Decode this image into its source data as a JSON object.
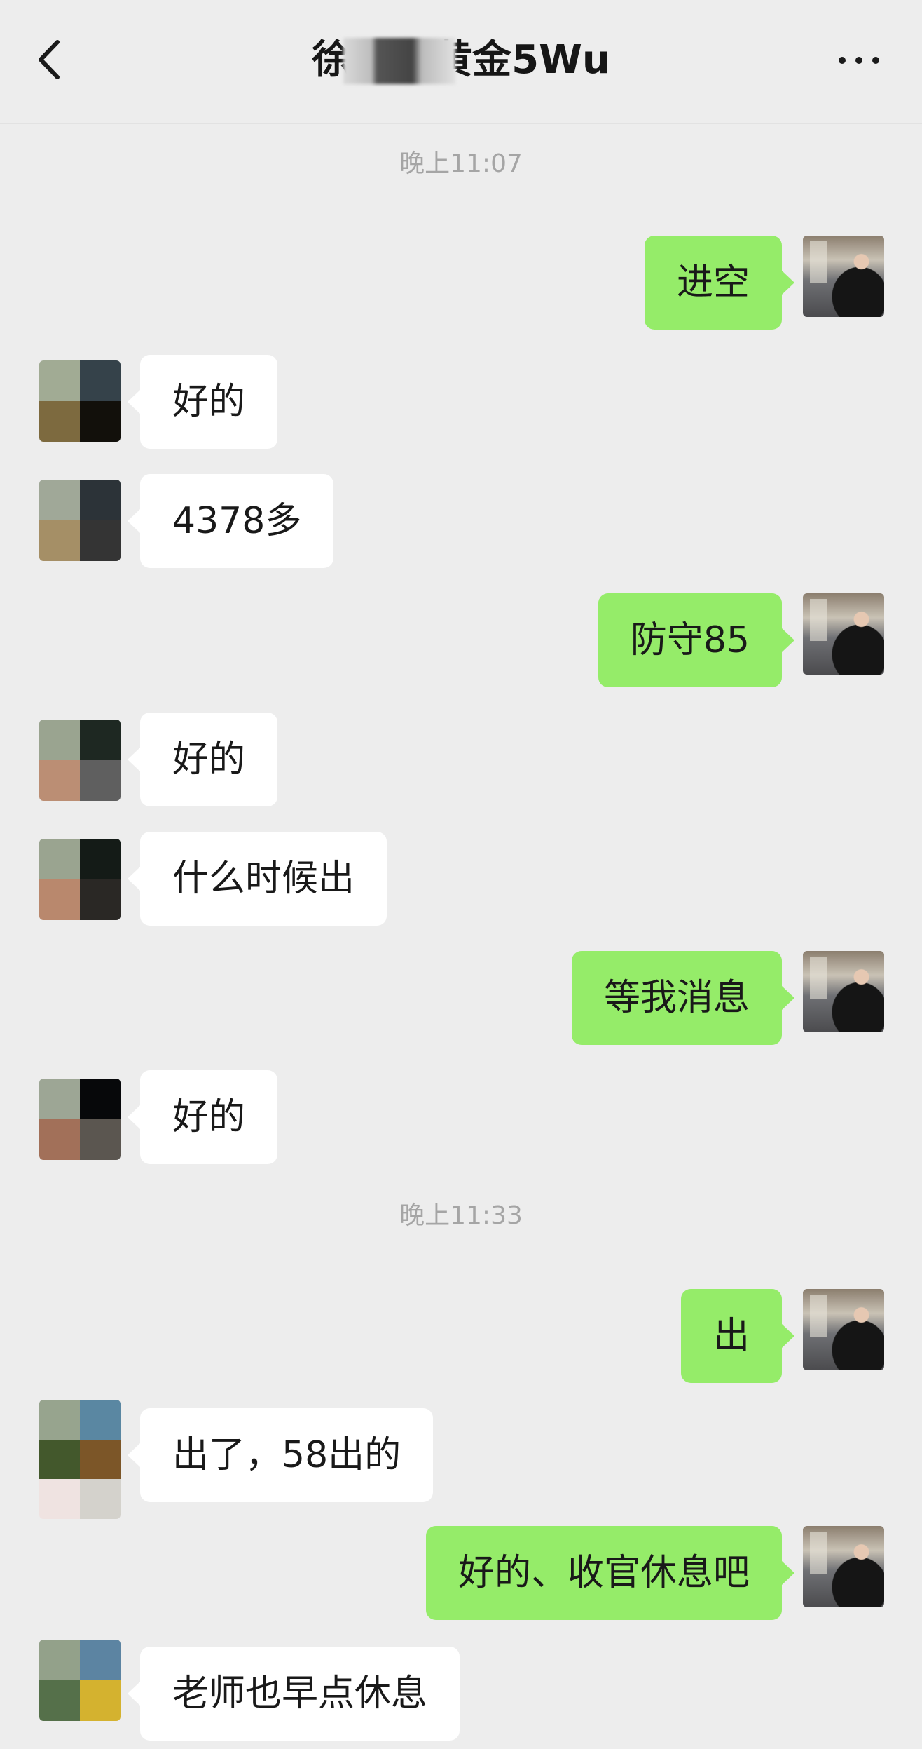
{
  "header": {
    "title": "徐      黄金5Wu",
    "back_icon": "chevron-left-icon",
    "more_icon": "more-dots-icon"
  },
  "timestamps": [
    "晚上11:07",
    "晚上11:33"
  ],
  "messages": [
    {
      "from": "me",
      "text": "进空"
    },
    {
      "from": "them",
      "text": "好的"
    },
    {
      "from": "them",
      "text": "4378多"
    },
    {
      "from": "me",
      "text": "防守85"
    },
    {
      "from": "them",
      "text": "好的"
    },
    {
      "from": "them",
      "text": "什么时候出"
    },
    {
      "from": "me",
      "text": "等我消息"
    },
    {
      "from": "them",
      "text": "好的"
    },
    {
      "from": "me",
      "text": "出"
    },
    {
      "from": "them",
      "text": "出了，58出的"
    },
    {
      "from": "me",
      "text": "好的、收官休息吧"
    },
    {
      "from": "them",
      "text": "老师也早点休息"
    }
  ],
  "colors": {
    "background": "#ededed",
    "my_bubble": "#95ec69",
    "their_bubble": "#ffffff",
    "timestamp_text": "#a5a5a5"
  }
}
